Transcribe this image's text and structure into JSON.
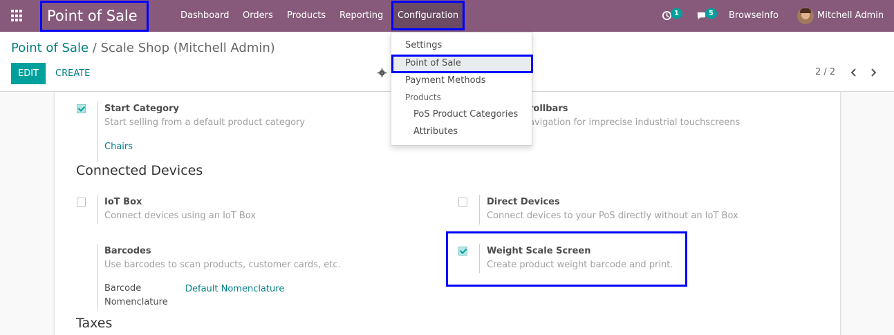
{
  "navbar": {
    "app_title": "Point of Sale",
    "menus": [
      "Dashboard",
      "Orders",
      "Products",
      "Reporting",
      "Configuration"
    ],
    "activity_count": "1",
    "messages_count": "5",
    "company": "BrowseInfo",
    "user": "Mitchell Admin",
    "brand_color": "#875a7b"
  },
  "control": {
    "breadcrumb_root": "Point of Sale",
    "breadcrumb_sep": "/",
    "breadcrumb_current": "Scale Shop (Mitchell Admin)",
    "edit_label": "EDIT",
    "create_label": "CREATE",
    "pager": "2 / 2"
  },
  "dropdown": {
    "items": [
      "Settings",
      "Point of Sale",
      "Payment Methods"
    ],
    "group_header": "Products",
    "sub_items": [
      "PoS Product Categories",
      "Attributes"
    ]
  },
  "settings": {
    "start_category": {
      "title": "Start Category",
      "desc": "Start selling from a default product category",
      "value": "Chairs",
      "checked": true
    },
    "large_scrollbars": {
      "title_partial": "rollbars",
      "desc_partial": "avigation for imprecise industrial touchscreens"
    },
    "connected_devices": {
      "heading": "Connected Devices",
      "iot_box": {
        "title": "IoT Box",
        "desc": "Connect devices using an IoT Box",
        "checked": false
      },
      "direct_devices": {
        "title": "Direct Devices",
        "desc": "Connect devices to your PoS directly without an IoT Box",
        "checked": false
      },
      "barcodes": {
        "title": "Barcodes",
        "desc": "Use barcodes to scan products, customer cards, etc.",
        "field_label_1": "Barcode",
        "field_label_2": "Nomenclature",
        "field_value": "Default Nomenclature"
      },
      "weight_scale": {
        "title": "Weight Scale Screen",
        "desc": "Create product weight barcode and print.",
        "checked": true
      }
    },
    "taxes_heading": "Taxes"
  },
  "accent_color": "#00a09d"
}
